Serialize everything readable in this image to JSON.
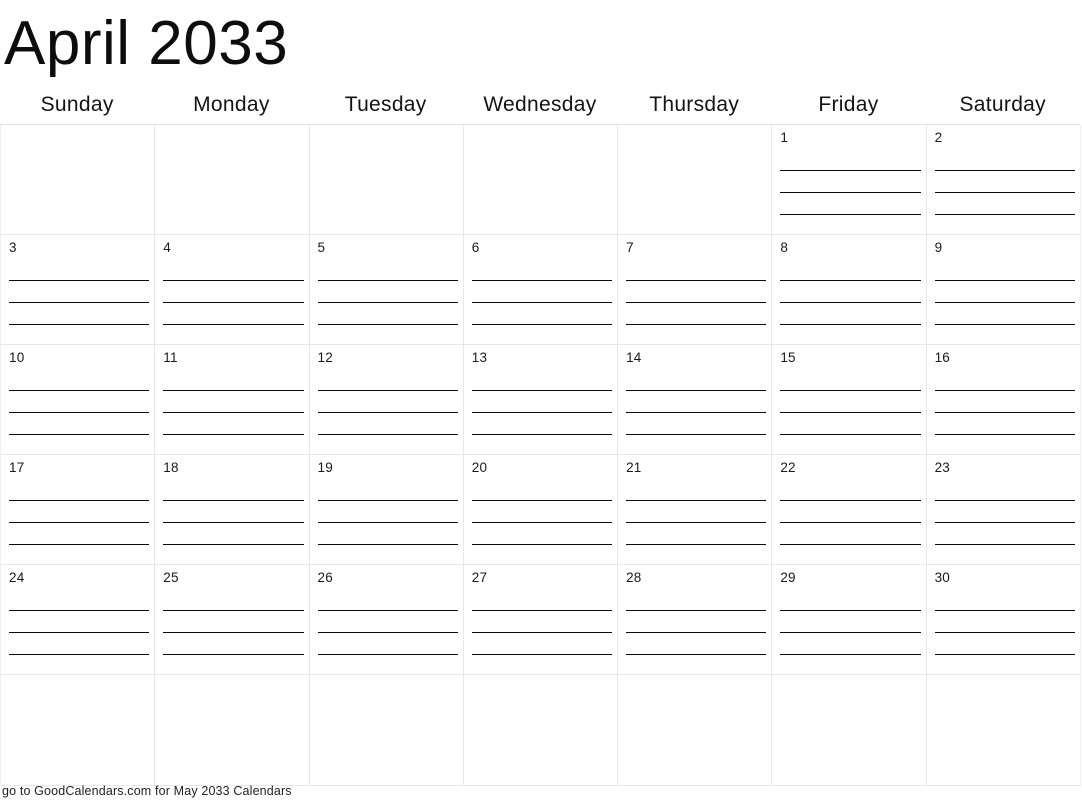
{
  "title": "April 2033",
  "weekdays": [
    "Sunday",
    "Monday",
    "Tuesday",
    "Wednesday",
    "Thursday",
    "Friday",
    "Saturday"
  ],
  "lines_per_cell": 4,
  "footer": "go to GoodCalendars.com for May 2033 Calendars",
  "colors": {
    "page_background": "#ffffff",
    "text": "#111111",
    "grid_line": "#e7e7e7",
    "write_line": "#0a0a0a"
  },
  "weeks": [
    [
      {
        "day": "",
        "lines": 0
      },
      {
        "day": "",
        "lines": 0
      },
      {
        "day": "",
        "lines": 0
      },
      {
        "day": "",
        "lines": 0
      },
      {
        "day": "",
        "lines": 0
      },
      {
        "day": "1",
        "lines": 4
      },
      {
        "day": "2",
        "lines": 4
      }
    ],
    [
      {
        "day": "3",
        "lines": 4
      },
      {
        "day": "4",
        "lines": 4
      },
      {
        "day": "5",
        "lines": 4
      },
      {
        "day": "6",
        "lines": 4
      },
      {
        "day": "7",
        "lines": 4
      },
      {
        "day": "8",
        "lines": 4
      },
      {
        "day": "9",
        "lines": 4
      }
    ],
    [
      {
        "day": "10",
        "lines": 4
      },
      {
        "day": "11",
        "lines": 4
      },
      {
        "day": "12",
        "lines": 4
      },
      {
        "day": "13",
        "lines": 4
      },
      {
        "day": "14",
        "lines": 4
      },
      {
        "day": "15",
        "lines": 4
      },
      {
        "day": "16",
        "lines": 4
      }
    ],
    [
      {
        "day": "17",
        "lines": 4
      },
      {
        "day": "18",
        "lines": 4
      },
      {
        "day": "19",
        "lines": 4
      },
      {
        "day": "20",
        "lines": 4
      },
      {
        "day": "21",
        "lines": 4
      },
      {
        "day": "22",
        "lines": 4
      },
      {
        "day": "23",
        "lines": 4
      }
    ],
    [
      {
        "day": "24",
        "lines": 4
      },
      {
        "day": "25",
        "lines": 4
      },
      {
        "day": "26",
        "lines": 4
      },
      {
        "day": "27",
        "lines": 4
      },
      {
        "day": "28",
        "lines": 4
      },
      {
        "day": "29",
        "lines": 4
      },
      {
        "day": "30",
        "lines": 4
      }
    ],
    [
      {
        "day": "",
        "lines": 0
      },
      {
        "day": "",
        "lines": 0
      },
      {
        "day": "",
        "lines": 0
      },
      {
        "day": "",
        "lines": 0
      },
      {
        "day": "",
        "lines": 0
      },
      {
        "day": "",
        "lines": 0
      },
      {
        "day": "",
        "lines": 0
      }
    ]
  ]
}
